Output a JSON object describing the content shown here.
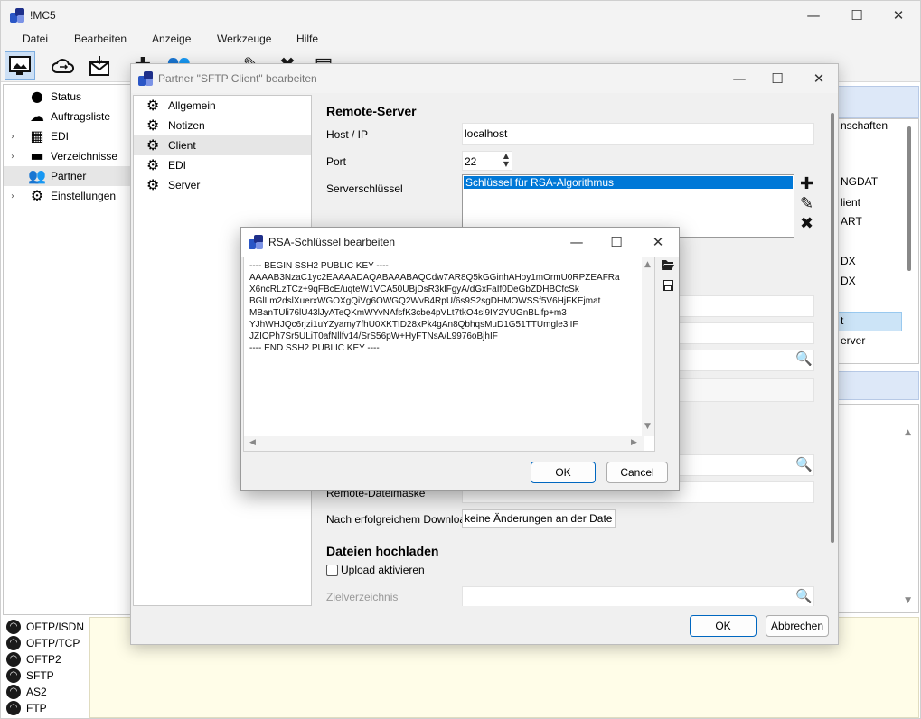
{
  "app": {
    "title": "!MC5",
    "menu": [
      "Datei",
      "Bearbeiten",
      "Anzeige",
      "Werkzeuge",
      "Hilfe"
    ]
  },
  "tree": {
    "items": [
      {
        "label": "Status",
        "icon": "status-icon",
        "expandable": false
      },
      {
        "label": "Auftragsliste",
        "icon": "cloud-sync-icon",
        "expandable": false
      },
      {
        "label": "EDI",
        "icon": "document-icon",
        "expandable": true
      },
      {
        "label": "Verzeichnisse",
        "icon": "folder-icon",
        "expandable": true
      },
      {
        "label": "Partner",
        "icon": "users-icon",
        "expandable": false,
        "selected": true
      },
      {
        "label": "Einstellungen",
        "icon": "gear-icon",
        "expandable": true
      }
    ]
  },
  "right_panel": {
    "items": [
      "nschaften",
      "NGDAT",
      "lient",
      "ART",
      "DX",
      "DX",
      "t",
      "erver"
    ]
  },
  "connections": [
    "OFTP/ISDN",
    "OFTP/TCP",
    "OFTP2",
    "SFTP",
    "AS2",
    "FTP"
  ],
  "partner_dialog": {
    "title": "Partner \"SFTP Client\" bearbeiten",
    "nav": [
      {
        "label": "Allgemein"
      },
      {
        "label": "Notizen"
      },
      {
        "label": "Client",
        "selected": true
      },
      {
        "label": "EDI"
      },
      {
        "label": "Server"
      }
    ],
    "remote_section": "Remote-Server",
    "host_label": "Host / IP",
    "host_value": "localhost",
    "port_label": "Port",
    "port_value": "22",
    "serverkey_label": "Serverschlüssel",
    "serverkey_item": "Schlüssel für RSA-Algorithmus",
    "remote_mask_label": "Remote-Dateimaske",
    "after_download_label": "Nach erfolgreichem Download..",
    "after_download_value": "keine Änderungen an der Date",
    "upload_section": "Dateien hochladen",
    "upload_checkbox_label": "Upload aktivieren",
    "target_dir_label": "Zielverzeichnis",
    "ok_label": "OK",
    "cancel_label": "Abbrechen"
  },
  "rsa_dialog": {
    "title": "RSA-Schlüssel bearbeiten",
    "lines": [
      "---- BEGIN SSH2 PUBLIC KEY ----",
      "AAAAB3NzaC1yc2EAAAADAQABAAABAQCdw7AR8Q5kGGinhAHoy1mOrmU0RPZEAFRa",
      "X6ncRLzTCz+9qFBcE/uqteW1VCA50UBjDsR3klFgyA/dGxFaIf0DeGbZDHBCfcSk",
      "BGlLm2dslXuerxWGOXgQiVg6OWGQ2WvB4RpU/6s9S2sgDHMOWSSf5V6HjFKEjmat",
      "MBanTUli76lU43lJyATeQKmWYvNAfsfK3cbe4pVLt7tkO4sl9IY2YUGnBLifp+m3",
      "YJhWHJQc6rjzi1uYZyamy7fhU0XKTID28xPk4gAn8QbhqsMuD1G51TTUmgle3lIF",
      "JZIOPh7Sr5ULiT0afNllfv14/SrS56pW+HyFTNsA/L9976oBjhIF",
      "---- END SSH2 PUBLIC KEY ----"
    ],
    "ok_label": "OK",
    "cancel_label": "Cancel"
  }
}
